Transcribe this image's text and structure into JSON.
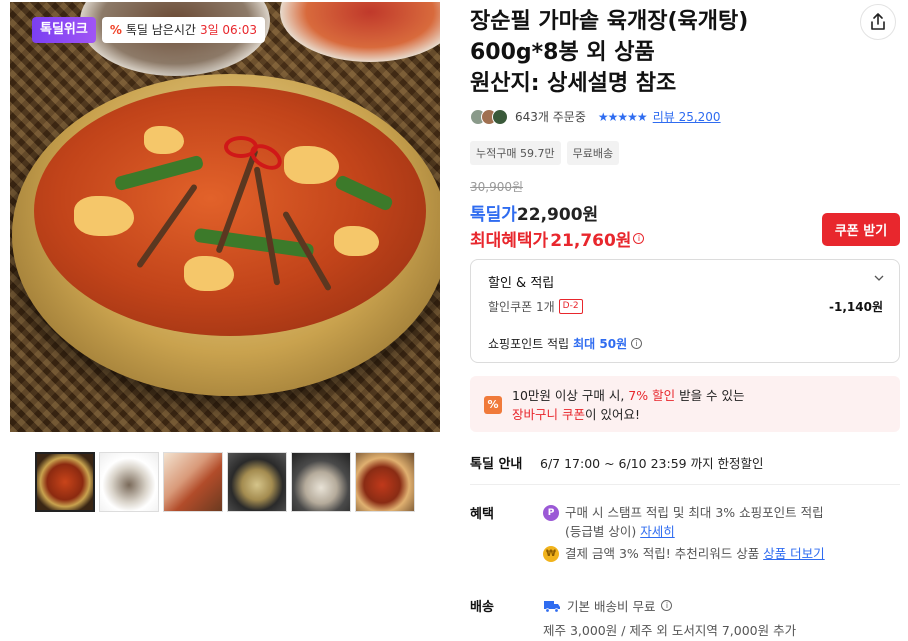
{
  "badge": {
    "brand": "톡딜위크",
    "percent": "%",
    "timer_label": "톡딜 남은시간",
    "timer_value": "3일 06:03"
  },
  "product": {
    "title": "장순필 가마솥 육개장(육개탕)\n600g*8봉 외 상품\n원산지: 상세설명 참조",
    "orders": "643개 주문중",
    "stars": "★★★★★",
    "review": "리뷰 25,200",
    "chips": [
      "누적구매 59.7만",
      "무료배송"
    ]
  },
  "price": {
    "original": "30,900원",
    "deal_label": "톡딜가",
    "deal_price": "22,900원",
    "max_label": "최대혜택가",
    "max_price": "21,760원",
    "info_icon": "ⓘ"
  },
  "coupon_button": "쿠폰 받기",
  "benefit_box": {
    "heading": "할인 & 적립",
    "chevron": "⌄",
    "coupon_label": "할인쿠폰 1개",
    "coupon_tag": "D-2",
    "coupon_amount": "-1,140원",
    "points_label": "쇼핑포인트 적립",
    "points_value": "최대 50원"
  },
  "promo": {
    "icon": "%",
    "line1_a": "10만원 이상 구매 시, ",
    "line1_b": "7% 할인",
    "line1_c": " 받을 수 있는",
    "line2_a": "장바구니 쿠폰",
    "line2_b": "이 있어요!"
  },
  "deal_info": {
    "label": "톡딜 안내",
    "value": "6/7 17:00 ~ 6/10 23:59 까지 한정할인"
  },
  "benefits": {
    "label": "혜택",
    "line1": "구매 시 스탬프 적립 및 최대 3% 쇼핑포인트 적립",
    "line1b": "(등급별 상이) ",
    "line1_link": "자세히",
    "line2": "결제 금액 3% 적립! 추천리워드 상품 ",
    "line2_link": "상품 더보기",
    "coin_p": "P",
    "coin_w": "₩"
  },
  "shipping": {
    "label": "배송",
    "line1": "기본 배송비 무료",
    "line2": "제주 3,000원 / 제주 외 도서지역 7,000원 추가"
  },
  "colors": {
    "accent_red": "#e8272d",
    "accent_blue": "#2f6cf0",
    "brand_purple": "#7b3ff2"
  },
  "icons": [
    "share-icon",
    "info-icon",
    "chevron-down-icon",
    "truck-icon",
    "percent-icon",
    "point-coin-icon",
    "won-coin-icon"
  ]
}
